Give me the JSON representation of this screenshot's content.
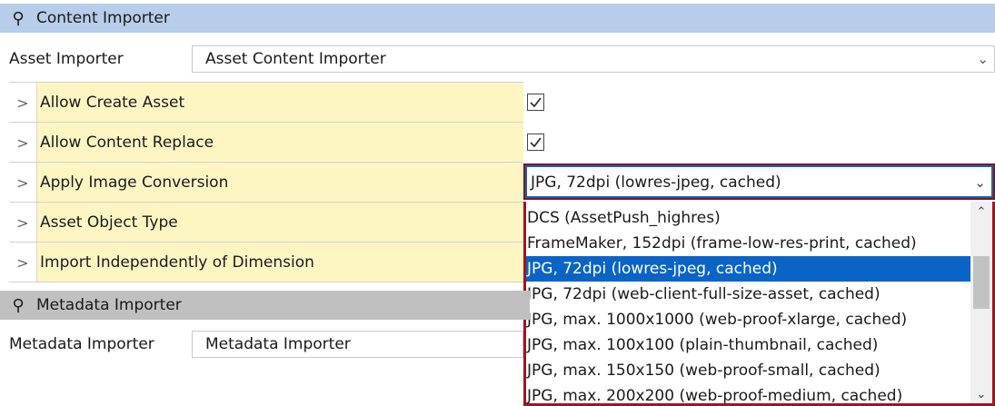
{
  "content_importer": {
    "section_title": "Content Importer",
    "pin_icon": "pin-icon",
    "asset_importer_label": "Asset Importer",
    "asset_importer_value": "Asset Content Importer",
    "header_color": "#b7cde9"
  },
  "properties": [
    {
      "label": "Allow Create Asset",
      "value_type": "checkbox",
      "checked": true
    },
    {
      "label": "Allow Content Replace",
      "value_type": "checkbox",
      "checked": true
    },
    {
      "label": "Apply Image Conversion",
      "value_type": "combo",
      "value": "JPG, 72dpi (lowres-jpeg, cached)"
    },
    {
      "label": "Asset Object Type",
      "value_type": "none"
    },
    {
      "label": "Import Independently of Dimension",
      "value_type": "none"
    }
  ],
  "dropdown": {
    "options": [
      "DCS (AssetPush_highres)",
      "FrameMaker, 152dpi (frame-low-res-print, cached)",
      "JPG, 72dpi (lowres-jpeg, cached)",
      "JPG, 72dpi (web-client-full-size-asset, cached)",
      "JPG, max. 1000x1000 (web-proof-xlarge, cached)",
      "JPG, max. 100x100 (plain-thumbnail, cached)",
      "JPG, max. 150x150 (web-proof-small, cached)",
      "JPG, max. 200x200 (web-proof-medium, cached)"
    ],
    "selected_index": 2,
    "selection_color": "#0a64c8",
    "highlight_border_color": "#a0151f"
  },
  "metadata_importer": {
    "section_title": "Metadata Importer",
    "label": "Metadata Importer",
    "value": "Metadata Importer"
  }
}
